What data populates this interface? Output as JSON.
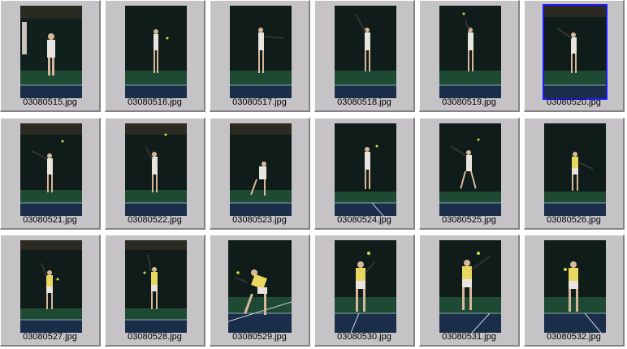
{
  "thumbnails": [
    {
      "filename": "03080515.jpg",
      "selected": false
    },
    {
      "filename": "03080516.jpg",
      "selected": false
    },
    {
      "filename": "03080517.jpg",
      "selected": false
    },
    {
      "filename": "03080518.jpg",
      "selected": false
    },
    {
      "filename": "03080519.jpg",
      "selected": false
    },
    {
      "filename": "03080520.jpg",
      "selected": true
    },
    {
      "filename": "03080521.jpg",
      "selected": false
    },
    {
      "filename": "03080522.jpg",
      "selected": false
    },
    {
      "filename": "03080523.jpg",
      "selected": false
    },
    {
      "filename": "03080524.jpg",
      "selected": false
    },
    {
      "filename": "03080525.jpg",
      "selected": false
    },
    {
      "filename": "03080526.jpg",
      "selected": false
    },
    {
      "filename": "03080527.jpg",
      "selected": false
    },
    {
      "filename": "03080528.jpg",
      "selected": false
    },
    {
      "filename": "03080529.jpg",
      "selected": false
    },
    {
      "filename": "03080530.jpg",
      "selected": false
    },
    {
      "filename": "03080531.jpg",
      "selected": false
    },
    {
      "filename": "03080532.jpg",
      "selected": false
    }
  ],
  "colors": {
    "cell_background": "#c6c3c6",
    "selection_border": "#1b1bff",
    "court_dark": "#0f1c1a",
    "court_green": "#1e4a34",
    "court_blue": "#1a2e4a"
  }
}
